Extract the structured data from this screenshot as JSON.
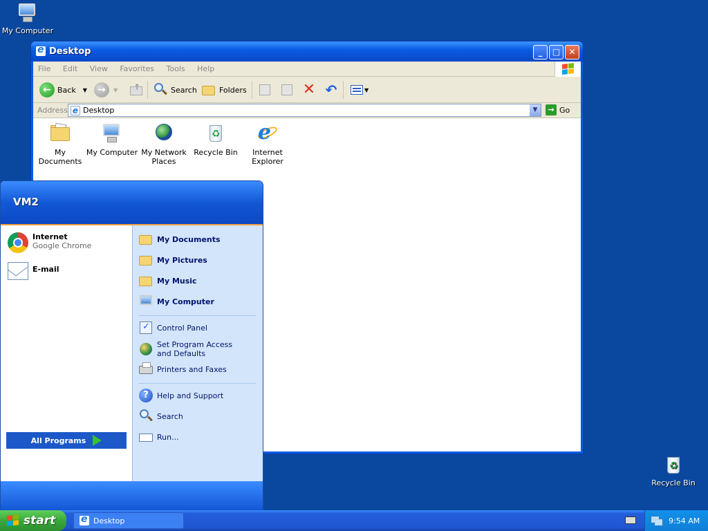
{
  "desktop": {
    "icons": [
      {
        "label": "My Computer"
      },
      {
        "label": "Recycle Bin"
      }
    ]
  },
  "window": {
    "title": "Desktop",
    "menu": [
      "File",
      "Edit",
      "View",
      "Favorites",
      "Tools",
      "Help"
    ],
    "toolbar": {
      "back_label": "Back",
      "search_label": "Search",
      "folders_label": "Folders"
    },
    "address": {
      "label": "Address",
      "value": "Desktop",
      "go_label": "Go"
    },
    "files": [
      {
        "label": "My Documents"
      },
      {
        "label": "My Computer"
      },
      {
        "label": "My Network Places"
      },
      {
        "label": "Recycle Bin"
      },
      {
        "label": "Internet Explorer"
      }
    ]
  },
  "start_menu": {
    "user": "VM2",
    "pinned": [
      {
        "name": "Internet",
        "sub": "Google Chrome"
      },
      {
        "name": "E-mail",
        "sub": ""
      }
    ],
    "all_programs": "All Programs",
    "places": [
      {
        "label": "My Documents"
      },
      {
        "label": "My Pictures"
      },
      {
        "label": "My Music"
      },
      {
        "label": "My Computer"
      }
    ],
    "settings": [
      {
        "label": "Control Panel"
      },
      {
        "label": "Set Program Access and Defaults"
      },
      {
        "label": "Printers and Faxes"
      }
    ],
    "tools": [
      {
        "label": "Help and Support"
      },
      {
        "label": "Search"
      },
      {
        "label": "Run..."
      }
    ]
  },
  "taskbar": {
    "start_label": "start",
    "task_item": "Desktop",
    "clock": "9:54 AM"
  },
  "colors": {
    "desktop": "#0a48a0",
    "titlebar": "#0a5ce4",
    "start_button": "#38a83a",
    "taskbar": "#245edb"
  }
}
